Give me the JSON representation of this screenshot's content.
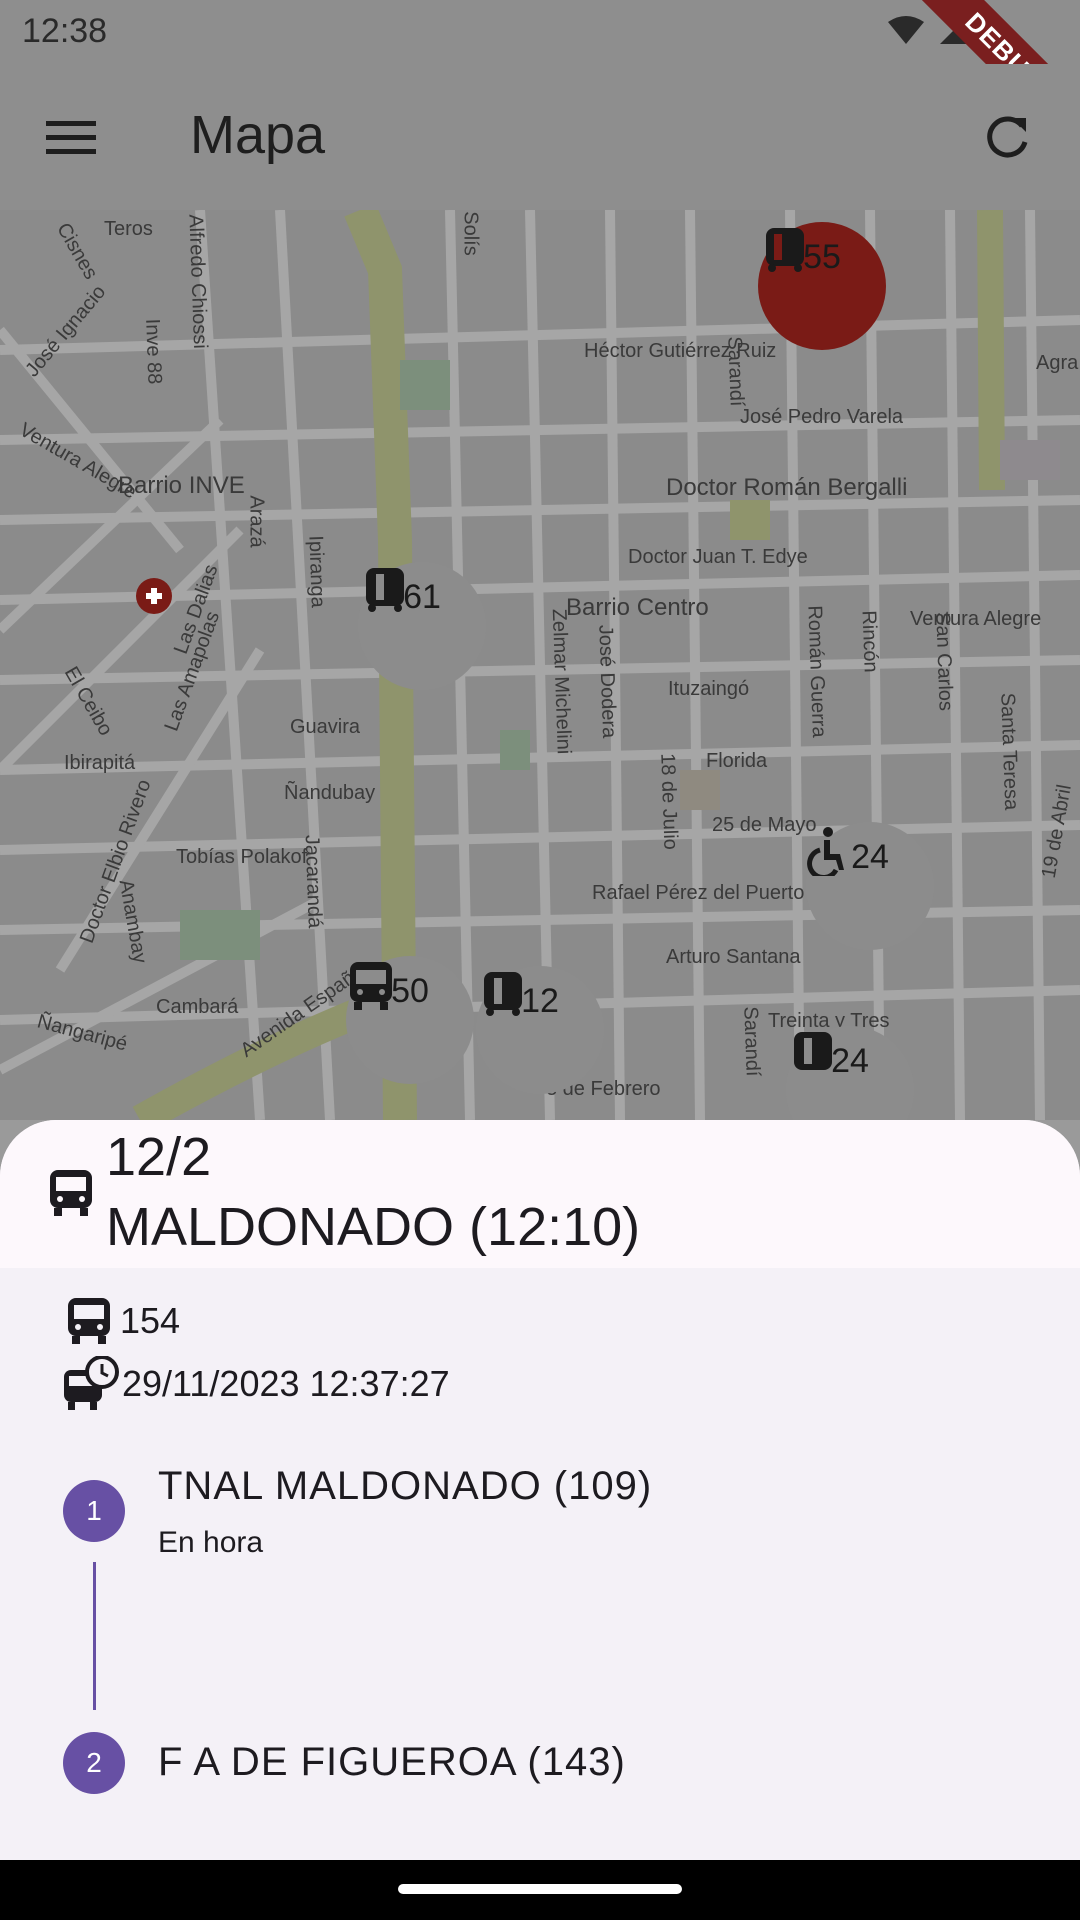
{
  "status_bar": {
    "time": "12:38",
    "debug_label": "DEBUG"
  },
  "app_bar": {
    "title": "Mapa",
    "menu_icon": "menu-icon",
    "refresh_icon": "refresh-icon"
  },
  "map": {
    "labels": [
      {
        "text": "Teros"
      },
      {
        "text": "Cisnes"
      },
      {
        "text": "Alfredo Chiossi"
      },
      {
        "text": "Solís"
      },
      {
        "text": "José Ignacio"
      },
      {
        "text": "Inve 88"
      },
      {
        "text": "Héctor Gutiérrez Ruiz"
      },
      {
        "text": "Agra"
      },
      {
        "text": "Ventura Alegre"
      },
      {
        "text": "José Pedro Varela"
      },
      {
        "text": "Barrio INVE"
      },
      {
        "text": "Doctor Román Bergalli"
      },
      {
        "text": "Ipiranga"
      },
      {
        "text": "Arazá"
      },
      {
        "text": "Doctor Juan T. Edye"
      },
      {
        "text": "Barrio Centro"
      },
      {
        "text": "Ventura Alegre"
      },
      {
        "text": "Las Dalias"
      },
      {
        "text": "Las Amapolas"
      },
      {
        "text": "Zelmar Michelini"
      },
      {
        "text": "José Dodera"
      },
      {
        "text": "Román Guerra"
      },
      {
        "text": "Rincón"
      },
      {
        "text": "San Carlos"
      },
      {
        "text": "El Ceibo"
      },
      {
        "text": "Ituzaingó"
      },
      {
        "text": "Guavira"
      },
      {
        "text": "Ibirapitá"
      },
      {
        "text": "Florida"
      },
      {
        "text": "Santa Teresa"
      },
      {
        "text": "Ñandubay"
      },
      {
        "text": "18 de Julio"
      },
      {
        "text": "25 de Mayo"
      },
      {
        "text": "19 de Abril"
      },
      {
        "text": "Tobías Polakof"
      },
      {
        "text": "Doctor Elbio Rivero"
      },
      {
        "text": "Jacarandá"
      },
      {
        "text": "Rafael Pérez del Puerto"
      },
      {
        "text": "Anambay"
      },
      {
        "text": "Arturo Santana"
      },
      {
        "text": "Cambará"
      },
      {
        "text": "Avenida España"
      },
      {
        "text": "Ñangaripé"
      },
      {
        "text": "Treinta y Tres"
      },
      {
        "text": "3 de Febrero"
      },
      {
        "text": "Sarandí"
      },
      {
        "text": "Sarandí"
      }
    ],
    "clusters": [
      {
        "count": "55",
        "icon": "train-icon",
        "highlight": true
      },
      {
        "count": "61",
        "icon": "train-icon",
        "highlight": false
      },
      {
        "count": "24",
        "icon": "wheelchair-icon",
        "highlight": false
      },
      {
        "count": "50",
        "icon": "bus-icon",
        "highlight": false
      },
      {
        "count": "12",
        "icon": "train-icon",
        "highlight": false
      },
      {
        "count": "24",
        "icon": "train-icon",
        "highlight": false
      }
    ]
  },
  "sheet": {
    "route_number": "12/2",
    "destination": "MALDONADO (12:10)",
    "vehicle_number": "154",
    "timestamp": "29/11/2023 12:37:27",
    "stops": [
      {
        "index": "1",
        "name": "TNAL MALDONADO (109)",
        "status": "En hora"
      },
      {
        "index": "2",
        "name": "F A DE FIGUEROA (143)"
      }
    ]
  },
  "colors": {
    "accent": "#6750a4",
    "highlight_cluster": "#7a1b16"
  }
}
